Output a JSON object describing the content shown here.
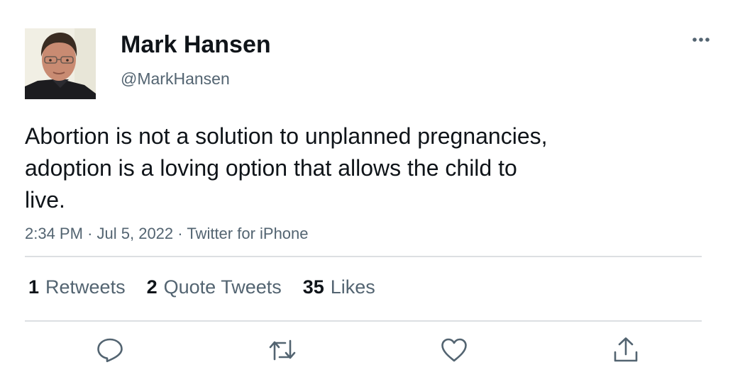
{
  "tweet": {
    "author": {
      "display_name": "Mark Hansen",
      "handle": "@MarkHansen"
    },
    "text": "Abortion is not a solution to unplanned pregnancies,\nadoption is a loving option that allows the child to\nlive.",
    "time": "2:34 PM",
    "date": "Jul 5, 2022",
    "source": "Twitter for iPhone",
    "separator": "·",
    "stats": {
      "retweets_count": "1",
      "retweets_label": "Retweets",
      "quotes_count": "2",
      "quotes_label": "Quote Tweets",
      "likes_count": "35",
      "likes_label": "Likes"
    },
    "icons": {
      "more": "more-icon",
      "reply": "reply-icon",
      "retweet": "retweet-icon",
      "like": "heart-icon",
      "share": "share-icon"
    },
    "colors": {
      "text": "#0f1419",
      "secondary": "#536471",
      "divider": "#dcdfe2",
      "background": "#ffffff"
    }
  }
}
